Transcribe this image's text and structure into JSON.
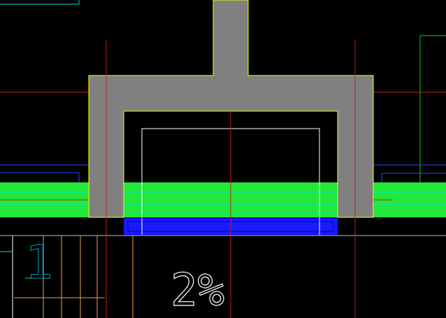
{
  "drawing": {
    "slope_annotation": "2%",
    "level_mark": "1"
  },
  "colors": {
    "background": "#000000",
    "wall_fill": "#808080",
    "wall_outline": "#ffff00",
    "fill_layer": "#22e83a",
    "drain_channel": "#1a1aff",
    "axis_red": "#c81e1e",
    "guide_cyan": "#00e0e0",
    "guide_blue": "#1e50ff",
    "guide_green": "#20c020",
    "outline_white": "#ffffff",
    "hatch_orange": "#f0a050",
    "text_white": "#ffffff"
  }
}
